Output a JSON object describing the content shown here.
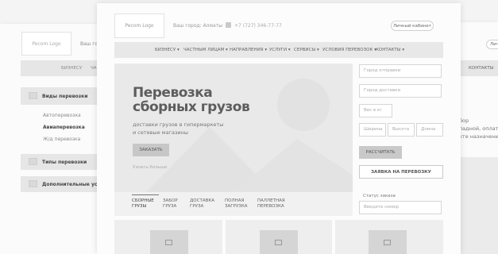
{
  "header": {
    "logo": "Pecom Logo",
    "city": "Ваш город: Алматы",
    "phone": "+7 (727) 346-77-77",
    "cabinet": "Личный кабинет"
  },
  "nav": [
    {
      "label": "БИЗНЕСУ"
    },
    {
      "label": "ЧАСТНЫМ ЛИЦАМ"
    },
    {
      "label": "НАПРАВЛЕНИЯ"
    },
    {
      "label": "УСЛУГИ"
    },
    {
      "label": "СЕРВИСЫ"
    },
    {
      "label": "УСЛОВИЯ ПЕРЕВОЗОК"
    },
    {
      "label": "КОНТАКТЫ"
    }
  ],
  "hero": {
    "title_line1": "Перевозка",
    "title_line2": "сборных грузов",
    "subtitle_line1": "доставки грузов в гипермаркеты",
    "subtitle_line2": "и сетевые магазины",
    "order": "ЗАКАЗАТЬ",
    "learn_more": "Узнать больше"
  },
  "tabs": [
    {
      "line1": "СБОРНЫЕ",
      "line2": "ГРУЗЫ"
    },
    {
      "line1": "ЗАБОР",
      "line2": "ГРУЗА"
    },
    {
      "line1": "ДОСТАВКА",
      "line2": "ГРУЗА"
    },
    {
      "line1": "ПОЛНАЯ",
      "line2": "ЗАГРУЗКА"
    },
    {
      "line1": "ПАЛЛЕТНАЯ",
      "line2": "ПЕРЕВОЗКА"
    }
  ],
  "form": {
    "from": "Город отправки",
    "to": "Город доставки",
    "weight": "Вес в кг",
    "width": "Ширина",
    "height": "Высота",
    "length": "Длина",
    "calculate": "РАССЧИТАТЬ",
    "request": "ЗАЯВКА НА ПЕРЕВОЗКУ",
    "status_label": "Статус заказа",
    "order_number": "Введите номер"
  },
  "ghost_left": {
    "logo": "Pecom Logo",
    "city": "Ваш гор",
    "nav1": "БИЗНЕСУ",
    "nav2": "ЧА",
    "sections": [
      {
        "label": "Виды перевозки"
      },
      {
        "label": "Типы перевозки"
      },
      {
        "label": "Дополнительные услуги"
      }
    ],
    "sub_items": [
      "Автоперевозка",
      "Авиаперевозка",
      "Ж/д перевозка"
    ]
  },
  "ghost_right": {
    "cabinet": "Личн",
    "nav": "КОНТАКТЫ",
    "text1": "бор",
    "text2": "ладной, оплату",
    "text3": "кте назначения"
  }
}
